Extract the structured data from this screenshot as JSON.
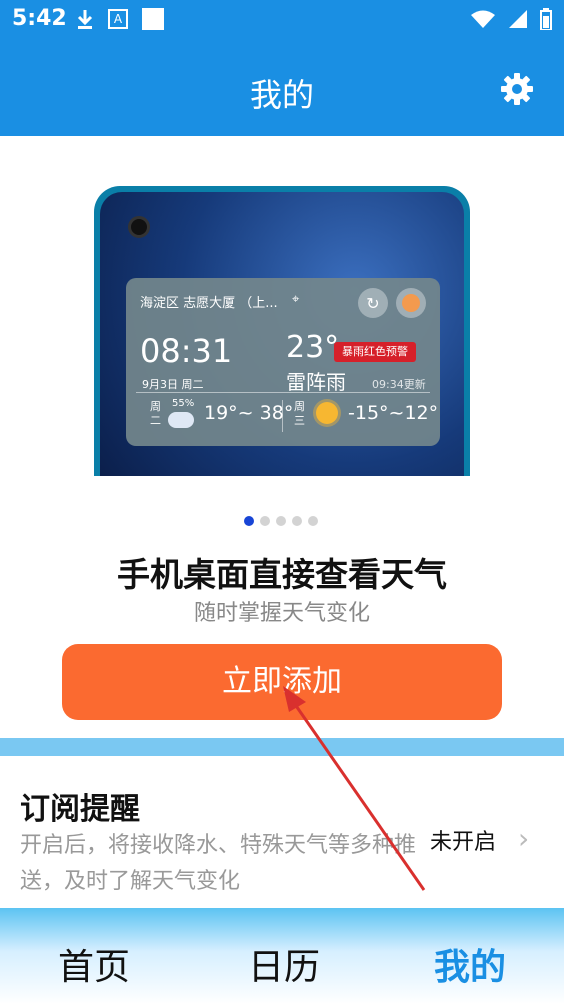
{
  "status_bar": {
    "time": "5:42",
    "badge_letter": "A"
  },
  "app_bar": {
    "title": "我的"
  },
  "banner": {
    "widget": {
      "location": "海淀区 志愿大厦 （上...",
      "time": "08:31",
      "date": "9月3日  周二",
      "temperature": "23°",
      "condition": "雷阵雨",
      "alert": "暴雨红色预警",
      "updated": "09:34更新",
      "forecast": [
        {
          "day": "周二",
          "humidity": "55%",
          "range": "19°~ 38°"
        },
        {
          "day": "周三",
          "range": "-15°~12°"
        }
      ]
    },
    "page_indicator": {
      "count": 5,
      "active": 0
    }
  },
  "promo": {
    "headline": "手机桌面直接查看天气",
    "subline": "随时掌握天气变化",
    "add_button": "立即添加"
  },
  "subscription": {
    "title": "订阅提醒",
    "description": "开启后，将接收降水、特殊天气等多种推送，及时了解天气变化",
    "status": "未开启"
  },
  "tab_bar": {
    "tabs": [
      {
        "label": "首页"
      },
      {
        "label": "日历"
      },
      {
        "label": "我的"
      }
    ],
    "active": 2
  },
  "colors": {
    "primary": "#1a8fe3",
    "button": "#fb6a30",
    "alert": "#d6202a",
    "annotation_arrow": "#d9302e"
  }
}
